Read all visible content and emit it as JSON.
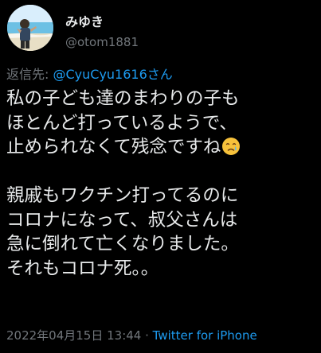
{
  "author": {
    "name": "みゆき",
    "handle": "@otom1881"
  },
  "reply": {
    "prefix": "返信先: ",
    "mention": "@CyuCyu1616さん"
  },
  "tweet": {
    "line1": "私の子ども達のまわりの子も",
    "line2": "ほとんど打っているようで、",
    "line3": "止められなくて残念ですね",
    "line3_emoji": "crying-face-emoji",
    "line4": "",
    "line5": "親戚もワクチン打ってるのに",
    "line6": "コロナになって、叔父さんは",
    "line7": "急に倒れて亡くなりました。",
    "line8": "それもコロナ死。。"
  },
  "meta": {
    "timestamp": "2022年04月15日 13:44",
    "separator": " · ",
    "source": "Twitter for iPhone"
  },
  "colors": {
    "background": "#000000",
    "text": "#e7e9ea",
    "secondary": "#71767b",
    "link": "#1d9bf0"
  }
}
